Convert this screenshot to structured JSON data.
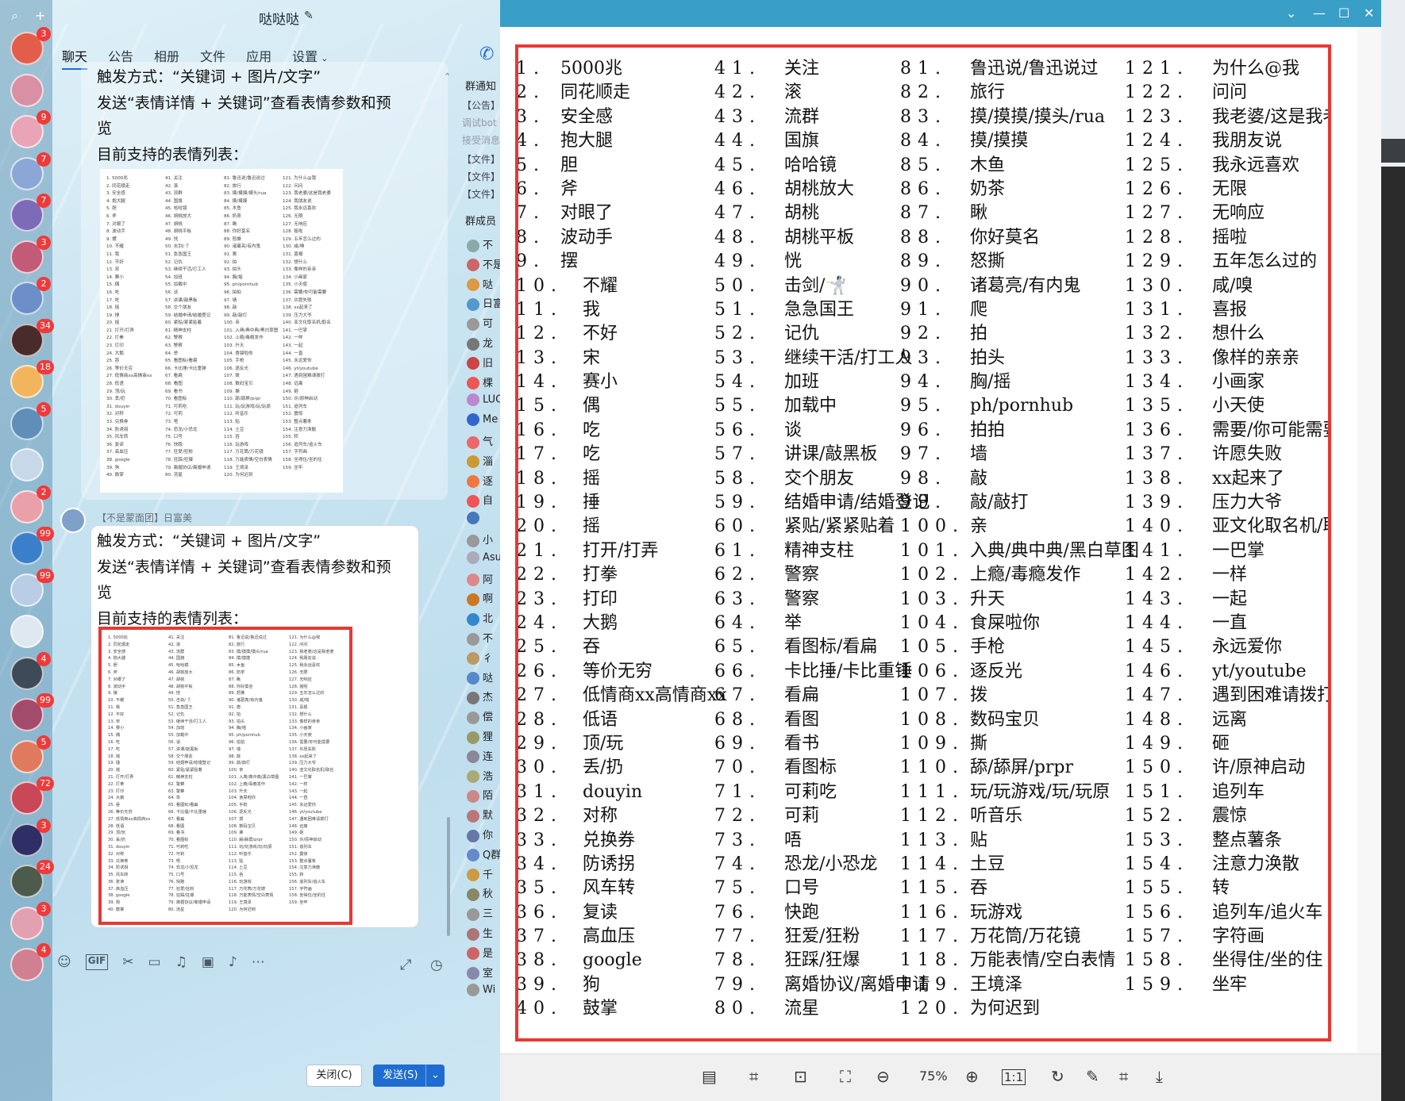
{
  "left": {
    "title": "哒哒哒",
    "tabs": [
      "聊天",
      "公告",
      "相册",
      "文件",
      "应用",
      "设置"
    ],
    "rail_badges": [
      "3",
      "",
      "9",
      "7",
      "7",
      "3",
      "2",
      "34",
      "18",
      "5",
      "",
      "2",
      "99",
      "99",
      "",
      "4",
      "99",
      "5",
      "72",
      "3",
      "24",
      "3",
      "4"
    ],
    "msg1": {
      "line1": "触发方式：“关键词 + 图片/文字”",
      "line2": "发送“表情详情 + 关键词”查看表情参数和预",
      "line3": "览",
      "line4": "目前支持的表情列表："
    },
    "sender": "【不是蒙面团】日富美",
    "msg2": {
      "line1": "触发方式：“关键词 + 图片/文字”",
      "line2": "发送“表情详情 + 关键词”查看表情参数和预",
      "line3": "览",
      "line4": "目前支持的表情列表："
    },
    "close_label": "关闭(C)",
    "send_label": "发送(S)",
    "side": {
      "notice_head": "群通知",
      "notice_items": [
        "【公告】",
        "调试bot",
        "接受消息",
        "【文件】",
        "【文件】",
        "【文件】"
      ],
      "members_head": "群成员",
      "members": [
        "不",
        "不是",
        "哒",
        "日富",
        "可",
        "龙",
        "旧",
        "棵",
        "LUC",
        "Me",
        "气",
        "淄",
        "逐",
        "自",
        "",
        "小",
        "Asu",
        "阿",
        "啊",
        "北",
        "不",
        "彳",
        "哒",
        "杰",
        "偿",
        "狸",
        "连",
        "浩",
        "陌",
        "默",
        "你",
        "Q群",
        "千",
        "秋",
        "三",
        "生",
        "是",
        "室",
        "Wi"
      ]
    }
  },
  "viewer": {
    "zoom": "75%",
    "columns": [
      [
        [
          "1.",
          "5000兆"
        ],
        [
          "2.",
          "同花顺走"
        ],
        [
          "3.",
          "安全感"
        ],
        [
          "4.",
          "抱大腿"
        ],
        [
          "5.",
          "胆"
        ],
        [
          "6.",
          "斧"
        ],
        [
          "7.",
          "对眼了"
        ],
        [
          "8.",
          "波动手"
        ],
        [
          "9.",
          "摆"
        ],
        [
          "10.",
          "不耀"
        ],
        [
          "11.",
          "我"
        ],
        [
          "12.",
          "不好"
        ],
        [
          "13.",
          "宋"
        ],
        [
          "14.",
          "赛小"
        ],
        [
          "15.",
          "偶"
        ],
        [
          "16.",
          "吃"
        ],
        [
          "17.",
          "吃"
        ],
        [
          "18.",
          "摇"
        ],
        [
          "19.",
          "捶"
        ],
        [
          "20.",
          "摇"
        ],
        [
          "21.",
          "打开/打弄"
        ],
        [
          "22.",
          "打拳"
        ],
        [
          "23.",
          "打印"
        ],
        [
          "24.",
          "大鹅"
        ],
        [
          "25.",
          "吞"
        ],
        [
          "26.",
          "等价无穷"
        ],
        [
          "27.",
          "低情商xx高情商xx"
        ],
        [
          "28.",
          "低语"
        ],
        [
          "29.",
          "顶/玩"
        ],
        [
          "30.",
          "丢/扔"
        ],
        [
          "31.",
          "douyin"
        ],
        [
          "32.",
          "对称"
        ],
        [
          "33.",
          "兑换券"
        ],
        [
          "34.",
          "防诱拐"
        ],
        [
          "35.",
          "风车转"
        ],
        [
          "36.",
          "复读"
        ],
        [
          "37.",
          "高血压"
        ],
        [
          "38.",
          "google"
        ],
        [
          "39.",
          "狗"
        ],
        [
          "40.",
          "鼓掌"
        ]
      ],
      [
        [
          "41.",
          "关注"
        ],
        [
          "42.",
          "滚"
        ],
        [
          "43.",
          "流群"
        ],
        [
          "44.",
          "国旗"
        ],
        [
          "45.",
          "哈哈镜"
        ],
        [
          "46.",
          "胡桃放大"
        ],
        [
          "47.",
          "胡桃"
        ],
        [
          "48.",
          "胡桃平板"
        ],
        [
          "49.",
          "恍"
        ],
        [
          "50.",
          "击剑/🤺"
        ],
        [
          "51.",
          "急急国王"
        ],
        [
          "52.",
          "记仇"
        ],
        [
          "53.",
          "继续干活/打工人"
        ],
        [
          "54.",
          "加班"
        ],
        [
          "55.",
          "加载中"
        ],
        [
          "56.",
          "谈"
        ],
        [
          "57.",
          "讲课/敲黑板"
        ],
        [
          "58.",
          "交个朋友"
        ],
        [
          "59.",
          "结婚申请/结婚登记"
        ],
        [
          "60.",
          "紧贴/紧紧贴着"
        ],
        [
          "61.",
          "精神支柱"
        ],
        [
          "62.",
          "警察"
        ],
        [
          "63.",
          "警察"
        ],
        [
          "64.",
          "举"
        ],
        [
          "65.",
          "看图标/看扁"
        ],
        [
          "66.",
          "卡比捶/卡比重锤"
        ],
        [
          "67.",
          "看扁"
        ],
        [
          "68.",
          "看图"
        ],
        [
          "69.",
          "看书"
        ],
        [
          "70.",
          "看图标"
        ],
        [
          "71.",
          "可莉吃"
        ],
        [
          "72.",
          "可莉"
        ],
        [
          "73.",
          "唔"
        ],
        [
          "74.",
          "恐龙/小恐龙"
        ],
        [
          "75.",
          "口号"
        ],
        [
          "76.",
          "快跑"
        ],
        [
          "77.",
          "狂爱/狂粉"
        ],
        [
          "78.",
          "狂踩/狂爆"
        ],
        [
          "79.",
          "离婚协议/离婚申请"
        ],
        [
          "80.",
          "流星"
        ]
      ],
      [
        [
          "81.",
          "鲁迅说/鲁迅说过"
        ],
        [
          "82.",
          "旅行"
        ],
        [
          "83.",
          "摸/摸摸/摸头/rua"
        ],
        [
          "84.",
          "摸/摸摸"
        ],
        [
          "85.",
          "木鱼"
        ],
        [
          "86.",
          "奶茶"
        ],
        [
          "87.",
          "瞅"
        ],
        [
          "88.",
          "你好莫名"
        ],
        [
          "89.",
          "怒撕"
        ],
        [
          "90.",
          "诸葛亮/有内鬼"
        ],
        [
          "91.",
          "爬"
        ],
        [
          "92.",
          "拍"
        ],
        [
          "93.",
          "拍头"
        ],
        [
          "94.",
          "胸/摇"
        ],
        [
          "95.",
          "ph/pornhub"
        ],
        [
          "96.",
          "拍拍"
        ],
        [
          "97.",
          "墙"
        ],
        [
          "98.",
          "敲"
        ],
        [
          "99.",
          "敲/敲打"
        ],
        [
          "100.",
          "亲"
        ],
        [
          "101.",
          "入典/典中典/黑白草图"
        ],
        [
          "102.",
          "上瘾/毒瘾发作"
        ],
        [
          "103.",
          "升天"
        ],
        [
          "104.",
          "食屎啦你"
        ],
        [
          "105.",
          "手枪"
        ],
        [
          "106.",
          "逐反光"
        ],
        [
          "107.",
          "拨"
        ],
        [
          "108.",
          "数码宝贝"
        ],
        [
          "109.",
          "撕"
        ],
        [
          "110.",
          "舔/舔屏/prpr"
        ],
        [
          "111.",
          "玩/玩游戏/玩/玩原"
        ],
        [
          "112.",
          "听音乐"
        ],
        [
          "113.",
          "贴"
        ],
        [
          "114.",
          "土豆"
        ],
        [
          "115.",
          "吞"
        ],
        [
          "116.",
          "玩游戏"
        ],
        [
          "117.",
          "万花筒/万花镜"
        ],
        [
          "118.",
          "万能表情/空白表情"
        ],
        [
          "119.",
          "王境泽"
        ],
        [
          "120.",
          "为何迟到"
        ]
      ],
      [
        [
          "121.",
          "为什么@我"
        ],
        [
          "122.",
          "问问"
        ],
        [
          "123.",
          "我老婆/这是我老婆"
        ],
        [
          "124.",
          "我朋友说"
        ],
        [
          "125.",
          "我永远喜欢"
        ],
        [
          "126.",
          "无限"
        ],
        [
          "127.",
          "无响应"
        ],
        [
          "128.",
          "摇啦"
        ],
        [
          "129.",
          "五年怎么过的"
        ],
        [
          "130.",
          "咸/嗅"
        ],
        [
          "131.",
          "喜报"
        ],
        [
          "132.",
          "想什么"
        ],
        [
          "133.",
          "像样的亲亲"
        ],
        [
          "134.",
          "小画家"
        ],
        [
          "135.",
          "小天使"
        ],
        [
          "136.",
          "需要/你可能需要"
        ],
        [
          "137.",
          "许愿失败"
        ],
        [
          "138.",
          "xx起来了"
        ],
        [
          "139.",
          "压力大爷"
        ],
        [
          "140.",
          "亚文化取名机/取名"
        ],
        [
          "141.",
          "一巴掌"
        ],
        [
          "142.",
          "一样"
        ],
        [
          "143.",
          "一起"
        ],
        [
          "144.",
          "一直"
        ],
        [
          "145.",
          "永远爱你"
        ],
        [
          "146.",
          "yt/youtube"
        ],
        [
          "147.",
          "遇到困难请拨打"
        ],
        [
          "148.",
          "远离"
        ],
        [
          "149.",
          "砸"
        ],
        [
          "150.",
          "许/原神启动"
        ],
        [
          "151.",
          "追列车"
        ],
        [
          "152.",
          "震惊"
        ],
        [
          "153.",
          "整点薯条"
        ],
        [
          "154.",
          "注意力涣散"
        ],
        [
          "155.",
          "转"
        ],
        [
          "156.",
          "追列车/追火车"
        ],
        [
          "157.",
          "字符画"
        ],
        [
          "158.",
          "坐得住/坐的住"
        ],
        [
          "159.",
          "坐牢"
        ]
      ]
    ]
  }
}
